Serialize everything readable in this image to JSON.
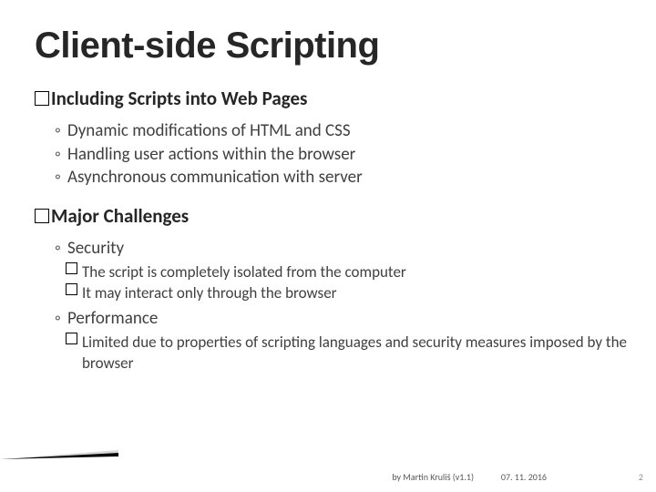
{
  "title": "Client-side Scripting",
  "section1": {
    "heading": "Including Scripts into Web Pages",
    "items": [
      "Dynamic modifications of HTML and CSS",
      "Handling user actions within the browser",
      "Asynchronous communication with server"
    ]
  },
  "section2": {
    "heading": "Major Challenges",
    "items": [
      {
        "label": "Security",
        "sub": [
          "The script is completely isolated from the computer",
          "It may interact only through the browser"
        ]
      },
      {
        "label": "Performance",
        "sub": [
          "Limited due to properties of scripting languages and security measures imposed by the browser"
        ]
      }
    ]
  },
  "footer": {
    "byline": "by Martin Kruliš (v1.1)",
    "date": "07. 11. 2016",
    "page": "2"
  }
}
